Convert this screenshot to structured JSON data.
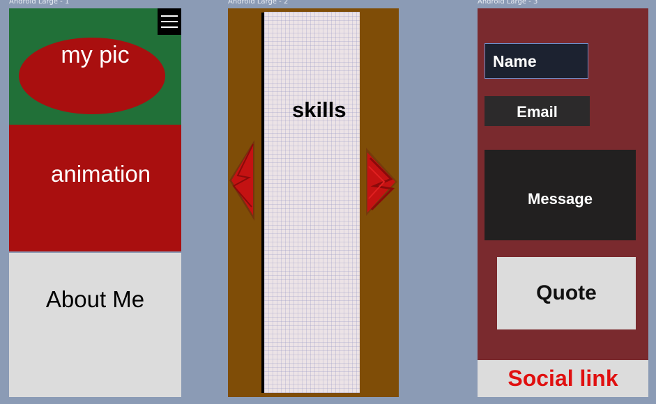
{
  "frames": [
    {
      "label": "Android Large - 1"
    },
    {
      "label": "Android Large - 2"
    },
    {
      "label": "Android Large - 3"
    }
  ],
  "screen1": {
    "pic_label": "my pic",
    "animation_label": "animation",
    "about_label": "About Me",
    "menu_icon": "hamburger-menu-icon"
  },
  "screen2": {
    "skills_label": "skills",
    "left_arrow_icon": "arrow-left-icon",
    "right_arrow_icon": "arrow-right-icon"
  },
  "screen3": {
    "name_label": "Name",
    "email_label": "Email",
    "message_label": "Message",
    "quote_label": "Quote",
    "social_label": "Social link"
  },
  "colors": {
    "canvas": "#8b9bb5",
    "green": "#217038",
    "red": "#a90f0f",
    "light_gray": "#dcdcdc",
    "brown": "#7f4d07",
    "maroon": "#7a2a2e",
    "social_text": "#e01010"
  }
}
